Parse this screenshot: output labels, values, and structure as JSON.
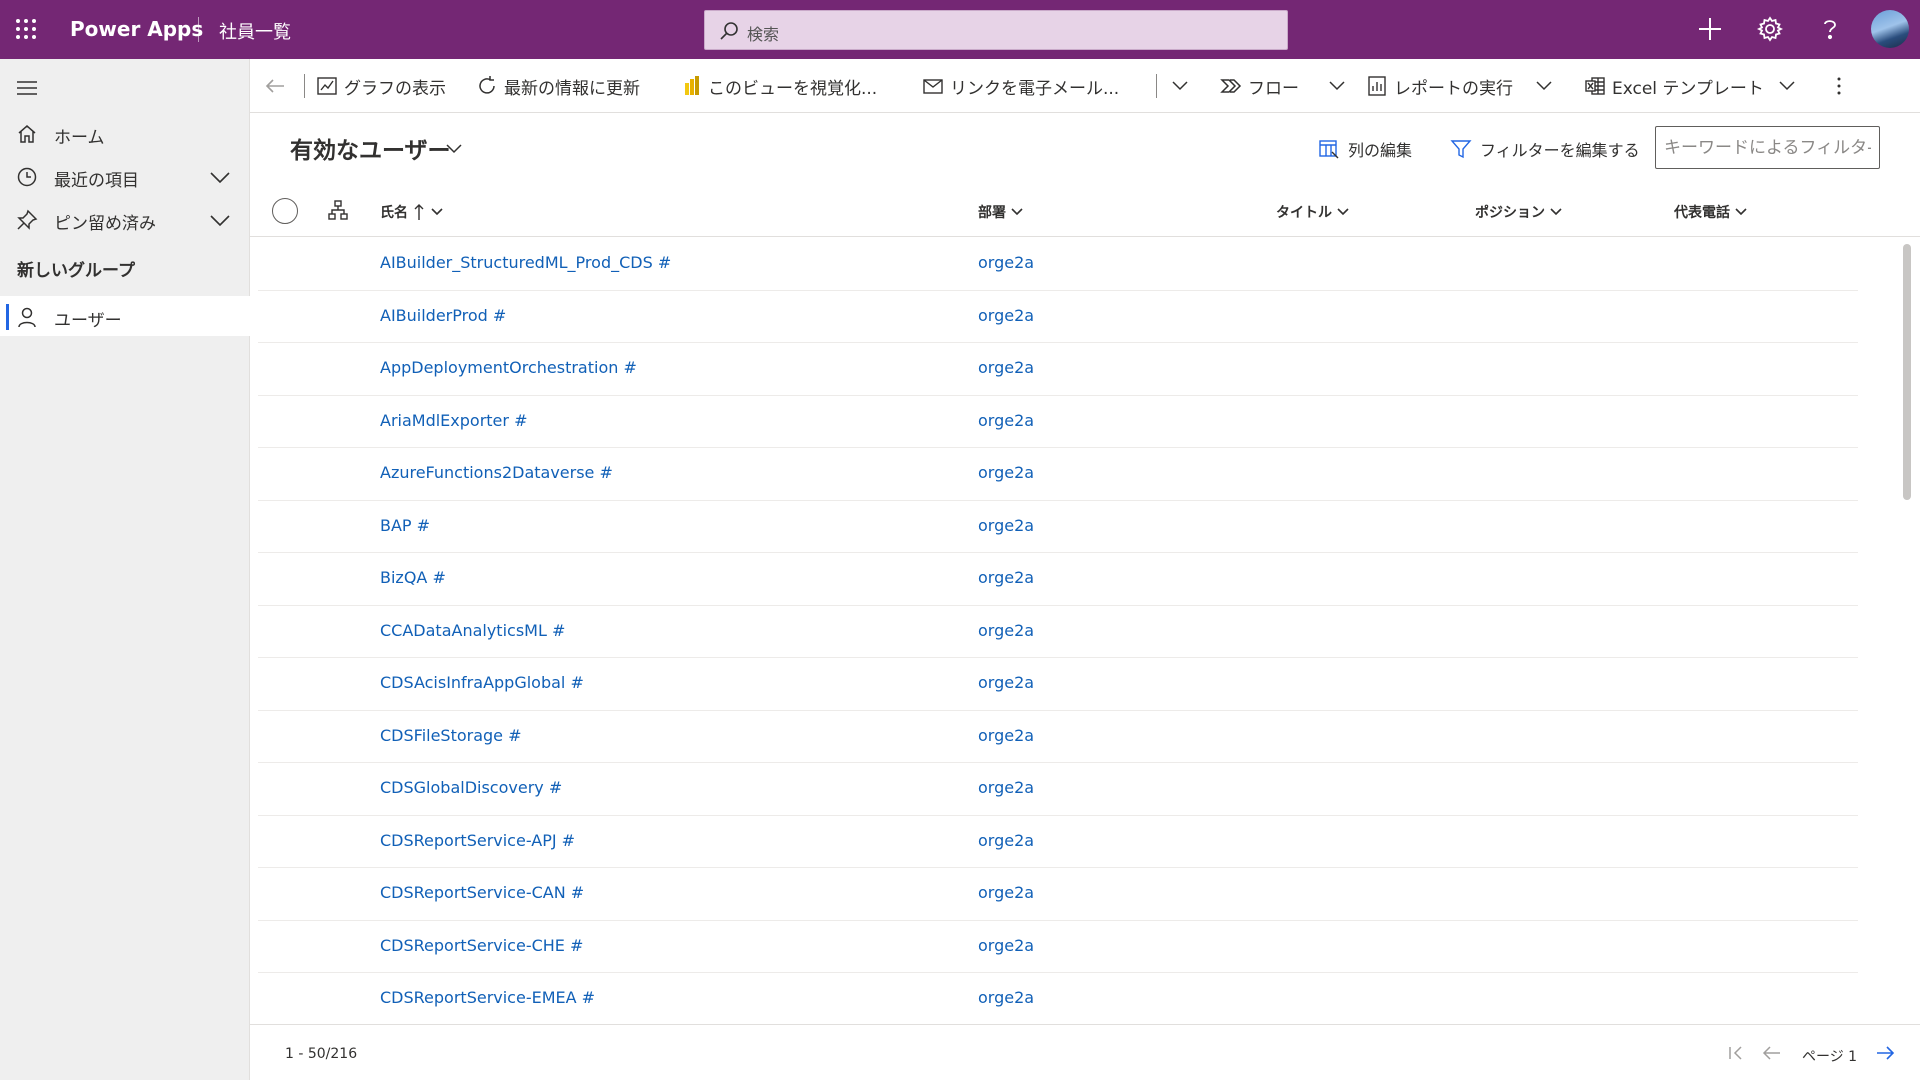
{
  "header": {
    "app_name": "Power Apps",
    "page_name": "社員一覧",
    "search_placeholder": "検索",
    "brand_color": "#742774"
  },
  "sidebar": {
    "items": [
      {
        "label": "ホーム",
        "icon": "home-icon"
      },
      {
        "label": "最近の項目",
        "icon": "clock-icon"
      },
      {
        "label": "ピン留め済み",
        "icon": "pin-icon"
      }
    ],
    "group_label": "新しいグループ",
    "group_items": [
      {
        "label": "ユーザー",
        "icon": "person-icon",
        "active": true
      }
    ]
  },
  "commands": {
    "show_chart": "グラフの表示",
    "refresh": "最新の情報に更新",
    "visualize": "このビューを視覚化...",
    "email_link": "リンクを電子メール...",
    "flow": "フロー",
    "run_report": "レポートの実行",
    "excel_template": "Excel テンプレート"
  },
  "view": {
    "title": "有効なユーザー",
    "edit_columns": "列の編集",
    "edit_filters": "フィルターを編集する",
    "keyword_filter_placeholder": "キーワードによるフィルタ-"
  },
  "grid": {
    "columns": [
      "氏名",
      "部署",
      "タイトル",
      "ポジション",
      "代表電話"
    ],
    "sorted_column": "氏名",
    "sort_direction": "ascending",
    "rows": [
      {
        "name": "AIBuilder_StructuredML_Prod_CDS #",
        "dept": "orge2a"
      },
      {
        "name": "AIBuilderProd #",
        "dept": "orge2a"
      },
      {
        "name": "AppDeploymentOrchestration #",
        "dept": "orge2a"
      },
      {
        "name": "AriaMdlExporter #",
        "dept": "orge2a"
      },
      {
        "name": "AzureFunctions2Dataverse #",
        "dept": "orge2a"
      },
      {
        "name": "BAP #",
        "dept": "orge2a"
      },
      {
        "name": "BizQA #",
        "dept": "orge2a"
      },
      {
        "name": "CCADataAnalyticsML #",
        "dept": "orge2a"
      },
      {
        "name": "CDSAcisInfraAppGlobal #",
        "dept": "orge2a"
      },
      {
        "name": "CDSFileStorage #",
        "dept": "orge2a"
      },
      {
        "name": "CDSGlobalDiscovery #",
        "dept": "orge2a"
      },
      {
        "name": "CDSReportService-APJ #",
        "dept": "orge2a"
      },
      {
        "name": "CDSReportService-CAN #",
        "dept": "orge2a"
      },
      {
        "name": "CDSReportService-CHE #",
        "dept": "orge2a"
      },
      {
        "name": "CDSReportService-EMEA #",
        "dept": "orge2a"
      }
    ],
    "link_color": "#1160b7"
  },
  "footer": {
    "record_count": "1 - 50/216",
    "page_label": "ページ 1"
  }
}
